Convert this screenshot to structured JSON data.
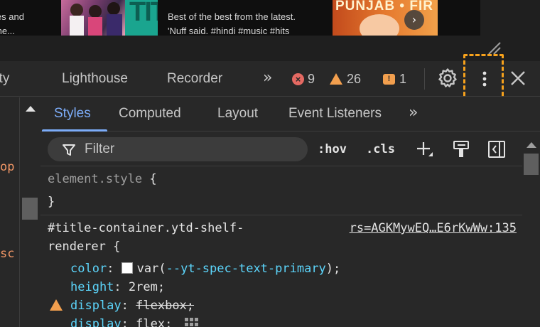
{
  "page_preview": {
    "left_snippet_line1": "ies and",
    "left_snippet_line2": "the...",
    "thumb1_label": "TITS",
    "mid_snippet_line1": "Best of the best from the latest.",
    "mid_snippet_line2": "'Nuff said. #hindi #music #hits",
    "thumb2_label": "PUNJAB • FIR",
    "next_icon": "chevron-right-icon"
  },
  "devtools_tabs": {
    "partial_tab": "rity",
    "tabs": [
      "Lighthouse",
      "Recorder"
    ],
    "more_tabs": "»",
    "errors": "9",
    "warnings": "26",
    "issues": "1"
  },
  "dom_panel": {
    "frag1": "op",
    "frag2": "sc"
  },
  "styles_tabs": {
    "items": [
      "Styles",
      "Computed",
      "Layout",
      "Event Listeners"
    ],
    "more": "»",
    "active": "Styles"
  },
  "filter": {
    "placeholder": "Filter",
    "hov": ":hov",
    "cls": ".cls"
  },
  "rules": {
    "element_style": {
      "selector": "element.style",
      "open": "{",
      "close": "}"
    },
    "title_container": {
      "selector_line1": "#title-container.ytd-shelf-",
      "selector_line2": "renderer",
      "open": "{",
      "source": "rs=AGKMywEQ…E6rKwWw:135",
      "declarations": [
        {
          "prop": "color",
          "value": "var(--yt-spec-text-primary);",
          "var_name": "--yt-spec-text-primary"
        },
        {
          "prop": "height",
          "value": "2rem;"
        },
        {
          "prop": "display",
          "value": "flexbox;",
          "struck": true,
          "warning": true
        },
        {
          "prop": "display",
          "value": "flex;"
        }
      ]
    }
  },
  "colors": {
    "accent_blue": "#7cacf8",
    "property_cyan": "#5cd5fb",
    "error_red": "#e46962",
    "warning_orange": "#f29f4e",
    "highlight_orange": "#f7a21c",
    "panel_bg": "#282828"
  }
}
